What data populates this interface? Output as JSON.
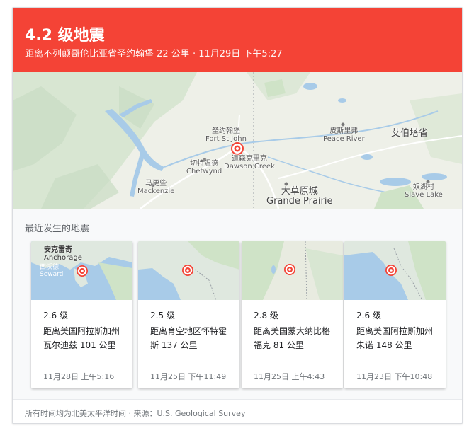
{
  "header": {
    "title": "4.2 级地震",
    "subtitle": "距离不列颠哥伦比亚省圣约翰堡 22 公里 · 11月29日 下午5:27",
    "background_color": "#f44336"
  },
  "map": {
    "labels": {
      "fort_st_john_zh": "圣约翰堡",
      "fort_st_john_en": "Fort St John",
      "dawson_creek_zh": "道森克里克",
      "dawson_creek_en": "Dawson Creek",
      "chetwynd_zh": "切特温德",
      "chetwynd_en": "Chetwynd",
      "mackenzie_zh": "马更些",
      "mackenzie_en": "Mackenzie",
      "peace_river_zh": "皮斯里弗",
      "peace_river_en": "Peace River",
      "alberta": "艾伯塔省",
      "grande_prairie_zh": "大草原城",
      "grande_prairie_en": "Grande Prairie",
      "slave_lake_zh": "奴湖村",
      "slave_lake_en": "Slave Lake"
    },
    "marker_icon": "earthquake-marker-icon"
  },
  "recent": {
    "section_title": "最近发生的地震",
    "items": [
      {
        "magnitude": "2.6 级",
        "location": "距离美国阿拉斯加州瓦尔迪兹 101 公里",
        "date": "11月28日 上午5:16",
        "thumb_labels": [
          "安克雷奇",
          "Anchorage",
          "西沃德",
          "Seward"
        ]
      },
      {
        "magnitude": "2.5 级",
        "location": "距离育空地区怀特霍斯 137 公里",
        "date": "11月25日 下午11:49"
      },
      {
        "magnitude": "2.8 级",
        "location": "距离美国蒙大纳比格福克 81 公里",
        "date": "11月25日 上午4:43"
      },
      {
        "magnitude": "2.6 级",
        "location": "距离美国阿拉斯加州朱诺 148 公里",
        "date": "11月23日 下午10:48"
      }
    ]
  },
  "footer": {
    "note": "所有时间均为北美太平洋时间 · 来源：U.S. Geological Survey"
  }
}
